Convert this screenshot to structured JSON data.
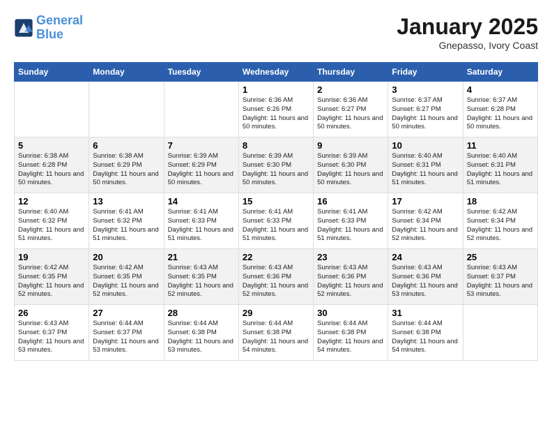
{
  "header": {
    "logo_line1": "General",
    "logo_line2": "Blue",
    "month": "January 2025",
    "location": "Gnepasso, Ivory Coast"
  },
  "weekdays": [
    "Sunday",
    "Monday",
    "Tuesday",
    "Wednesday",
    "Thursday",
    "Friday",
    "Saturday"
  ],
  "weeks": [
    [
      {
        "day": "",
        "info": ""
      },
      {
        "day": "",
        "info": ""
      },
      {
        "day": "",
        "info": ""
      },
      {
        "day": "1",
        "info": "Sunrise: 6:36 AM\nSunset: 6:26 PM\nDaylight: 11 hours and 50 minutes."
      },
      {
        "day": "2",
        "info": "Sunrise: 6:36 AM\nSunset: 6:27 PM\nDaylight: 11 hours and 50 minutes."
      },
      {
        "day": "3",
        "info": "Sunrise: 6:37 AM\nSunset: 6:27 PM\nDaylight: 11 hours and 50 minutes."
      },
      {
        "day": "4",
        "info": "Sunrise: 6:37 AM\nSunset: 6:28 PM\nDaylight: 11 hours and 50 minutes."
      }
    ],
    [
      {
        "day": "5",
        "info": "Sunrise: 6:38 AM\nSunset: 6:28 PM\nDaylight: 11 hours and 50 minutes."
      },
      {
        "day": "6",
        "info": "Sunrise: 6:38 AM\nSunset: 6:29 PM\nDaylight: 11 hours and 50 minutes."
      },
      {
        "day": "7",
        "info": "Sunrise: 6:39 AM\nSunset: 6:29 PM\nDaylight: 11 hours and 50 minutes."
      },
      {
        "day": "8",
        "info": "Sunrise: 6:39 AM\nSunset: 6:30 PM\nDaylight: 11 hours and 50 minutes."
      },
      {
        "day": "9",
        "info": "Sunrise: 6:39 AM\nSunset: 6:30 PM\nDaylight: 11 hours and 50 minutes."
      },
      {
        "day": "10",
        "info": "Sunrise: 6:40 AM\nSunset: 6:31 PM\nDaylight: 11 hours and 51 minutes."
      },
      {
        "day": "11",
        "info": "Sunrise: 6:40 AM\nSunset: 6:31 PM\nDaylight: 11 hours and 51 minutes."
      }
    ],
    [
      {
        "day": "12",
        "info": "Sunrise: 6:40 AM\nSunset: 6:32 PM\nDaylight: 11 hours and 51 minutes."
      },
      {
        "day": "13",
        "info": "Sunrise: 6:41 AM\nSunset: 6:32 PM\nDaylight: 11 hours and 51 minutes."
      },
      {
        "day": "14",
        "info": "Sunrise: 6:41 AM\nSunset: 6:33 PM\nDaylight: 11 hours and 51 minutes."
      },
      {
        "day": "15",
        "info": "Sunrise: 6:41 AM\nSunset: 6:33 PM\nDaylight: 11 hours and 51 minutes."
      },
      {
        "day": "16",
        "info": "Sunrise: 6:41 AM\nSunset: 6:33 PM\nDaylight: 11 hours and 51 minutes."
      },
      {
        "day": "17",
        "info": "Sunrise: 6:42 AM\nSunset: 6:34 PM\nDaylight: 11 hours and 52 minutes."
      },
      {
        "day": "18",
        "info": "Sunrise: 6:42 AM\nSunset: 6:34 PM\nDaylight: 11 hours and 52 minutes."
      }
    ],
    [
      {
        "day": "19",
        "info": "Sunrise: 6:42 AM\nSunset: 6:35 PM\nDaylight: 11 hours and 52 minutes."
      },
      {
        "day": "20",
        "info": "Sunrise: 6:42 AM\nSunset: 6:35 PM\nDaylight: 11 hours and 52 minutes."
      },
      {
        "day": "21",
        "info": "Sunrise: 6:43 AM\nSunset: 6:35 PM\nDaylight: 11 hours and 52 minutes."
      },
      {
        "day": "22",
        "info": "Sunrise: 6:43 AM\nSunset: 6:36 PM\nDaylight: 11 hours and 52 minutes."
      },
      {
        "day": "23",
        "info": "Sunrise: 6:43 AM\nSunset: 6:36 PM\nDaylight: 11 hours and 52 minutes."
      },
      {
        "day": "24",
        "info": "Sunrise: 6:43 AM\nSunset: 6:36 PM\nDaylight: 11 hours and 53 minutes."
      },
      {
        "day": "25",
        "info": "Sunrise: 6:43 AM\nSunset: 6:37 PM\nDaylight: 11 hours and 53 minutes."
      }
    ],
    [
      {
        "day": "26",
        "info": "Sunrise: 6:43 AM\nSunset: 6:37 PM\nDaylight: 11 hours and 53 minutes."
      },
      {
        "day": "27",
        "info": "Sunrise: 6:44 AM\nSunset: 6:37 PM\nDaylight: 11 hours and 53 minutes."
      },
      {
        "day": "28",
        "info": "Sunrise: 6:44 AM\nSunset: 6:38 PM\nDaylight: 11 hours and 53 minutes."
      },
      {
        "day": "29",
        "info": "Sunrise: 6:44 AM\nSunset: 6:38 PM\nDaylight: 11 hours and 54 minutes."
      },
      {
        "day": "30",
        "info": "Sunrise: 6:44 AM\nSunset: 6:38 PM\nDaylight: 11 hours and 54 minutes."
      },
      {
        "day": "31",
        "info": "Sunrise: 6:44 AM\nSunset: 6:38 PM\nDaylight: 11 hours and 54 minutes."
      },
      {
        "day": "",
        "info": ""
      }
    ]
  ]
}
